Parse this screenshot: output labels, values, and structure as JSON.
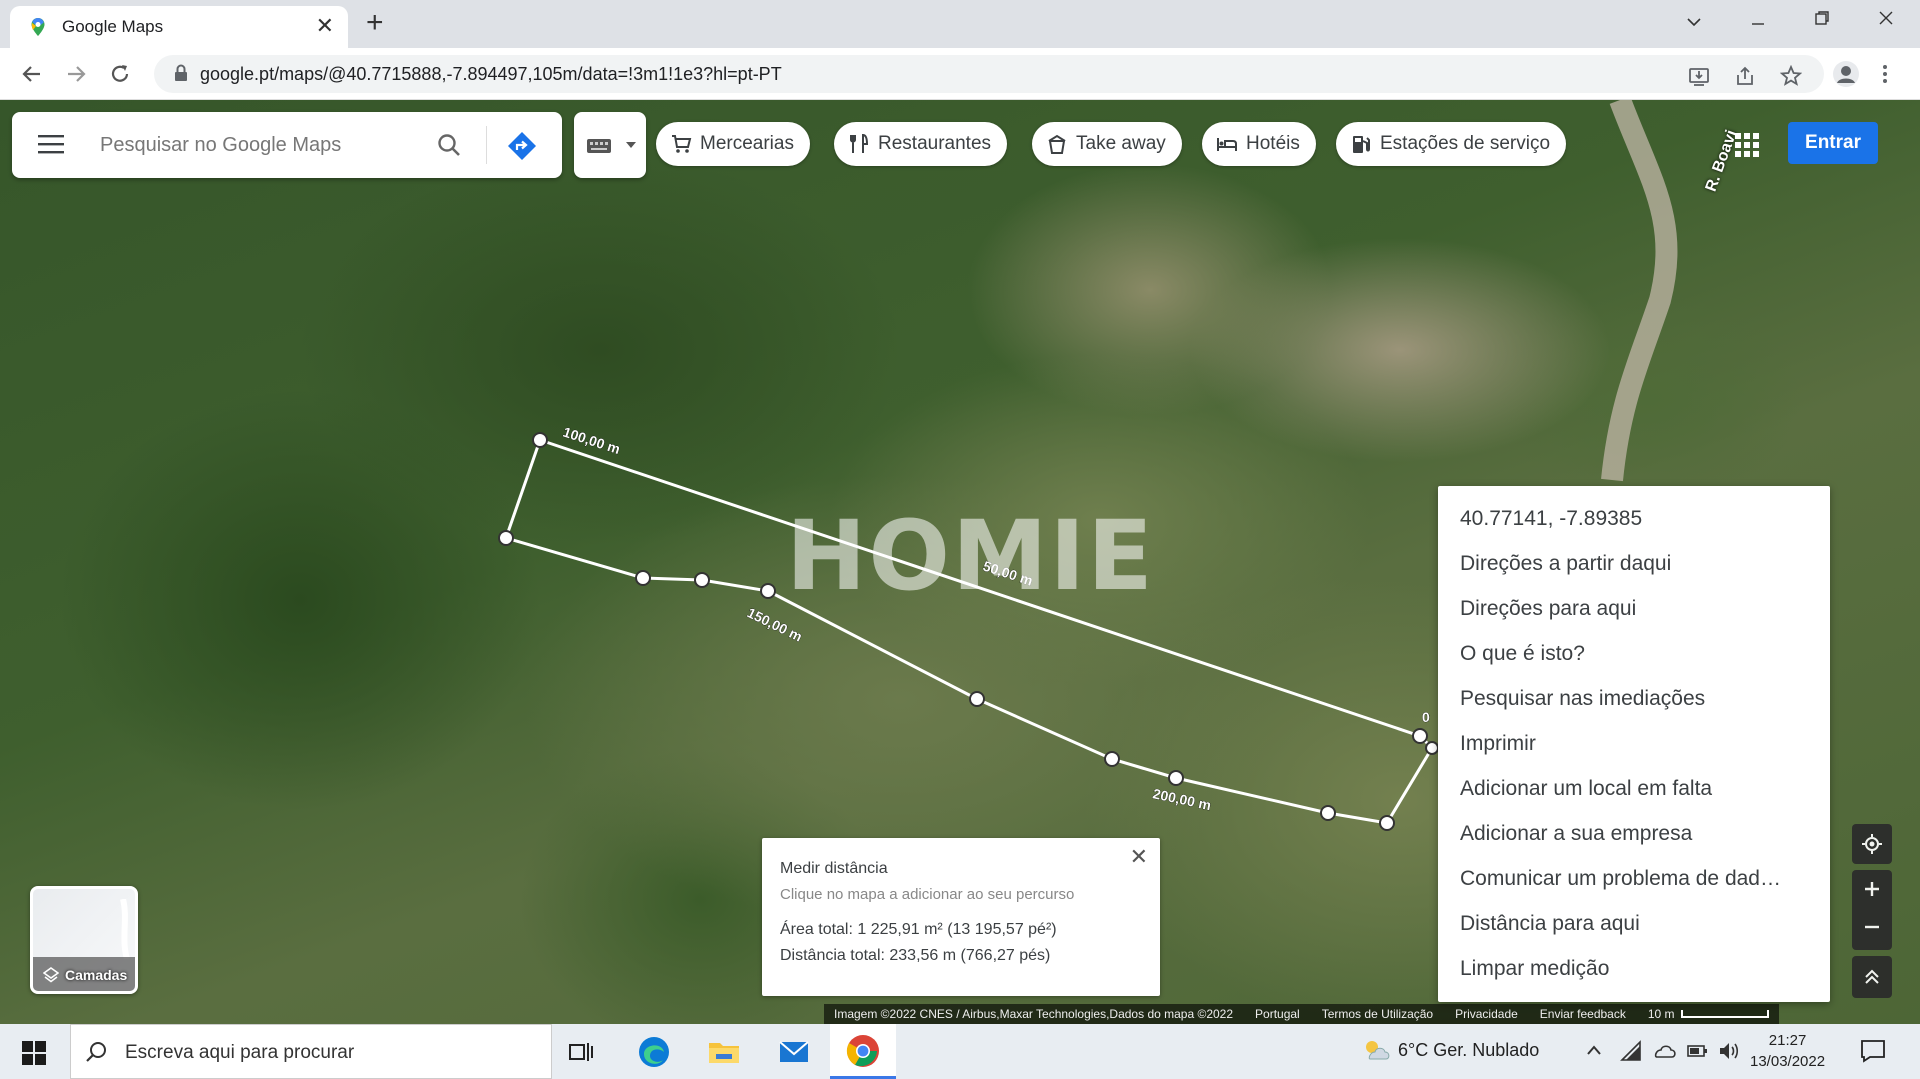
{
  "browser": {
    "tab_title": "Google Maps",
    "tab_close": "✕",
    "new_tab": "+",
    "url": "google.pt/maps/@40.7715888,-7.894497,105m/data=!3m1!1e3?hl=pt-PT"
  },
  "maps": {
    "search_placeholder": "Pesquisar no Google Maps",
    "chips": [
      {
        "label": "Mercearias",
        "icon": "cart-icon"
      },
      {
        "label": "Restaurantes",
        "icon": "restaurant-icon"
      },
      {
        "label": "Take away",
        "icon": "takeaway-icon"
      },
      {
        "label": "Hotéis",
        "icon": "hotel-icon"
      },
      {
        "label": "Estações de serviço",
        "icon": "gas-station-icon"
      }
    ],
    "sign_in": "Entrar",
    "road_label": "R. Boavi",
    "watermark": "HOMIE",
    "segment_labels": [
      "100,00 m",
      "50,00 m",
      "150,00 m",
      "200,00 m",
      "0"
    ],
    "context_menu": [
      "40.77141, -7.89385",
      "Direções a partir daqui",
      "Direções para aqui",
      "O que é isto?",
      "Pesquisar nas imediações",
      "Imprimir",
      "Adicionar um local em falta",
      "Adicionar a sua empresa",
      "Comunicar um problema de dad…",
      "Distância para aqui",
      "Limpar medição"
    ],
    "measure": {
      "title": "Medir distância",
      "hint": "Clique no mapa a adicionar ao seu percurso",
      "area": "Área total: 1 225,91 m² (13 195,57 pé²)",
      "distance": "Distância total: 233,56 m (766,27 pés)",
      "close": "✕"
    },
    "layers_label": "Camadas",
    "attribution": {
      "imagery": "Imagem ©2022 CNES / Airbus,Maxar Technologies,Dados do mapa ©2022",
      "country": "Portugal",
      "terms": "Termos de Utilização",
      "privacy": "Privacidade",
      "feedback": "Enviar feedback",
      "scale": "10 m"
    }
  },
  "taskbar": {
    "search_text": "Escreva aqui para procurar",
    "weather": "6°C  Ger. Nublado",
    "time": "21:27",
    "date": "13/03/2022"
  },
  "colors": {
    "accent": "#1a73e8",
    "measure_line": "#ffffff"
  }
}
